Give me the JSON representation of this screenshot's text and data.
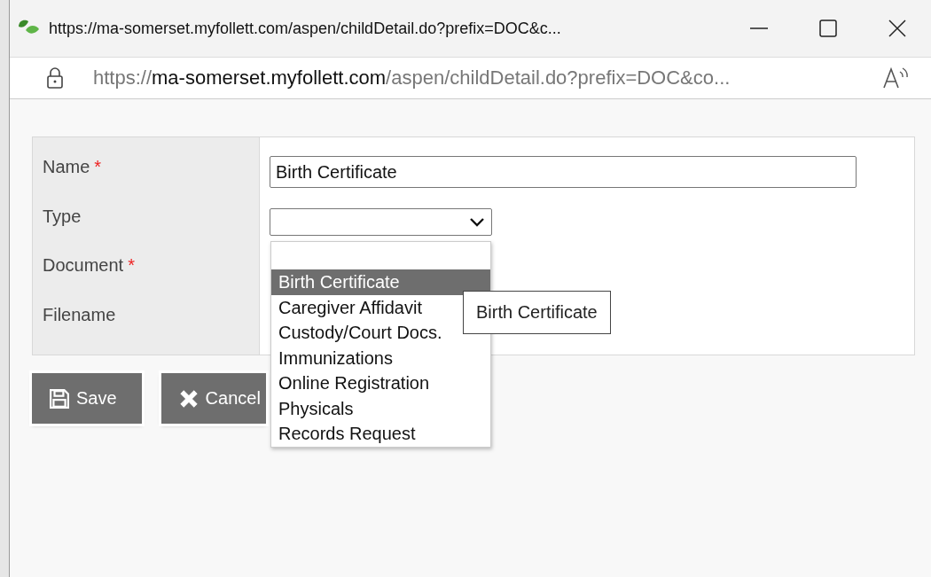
{
  "window": {
    "title": "https://ma-somerset.myfollett.com/aspen/childDetail.do?prefix=DOC&c..."
  },
  "address_bar": {
    "scheme": "https://",
    "host": "ma-somerset.myfollett.com",
    "path": "/aspen/childDetail.do?prefix=DOC&co..."
  },
  "form": {
    "fields": [
      {
        "label": "Name",
        "required_mark": "*",
        "kind": "text",
        "value": "Birth Certificate"
      },
      {
        "label": "Type",
        "kind": "select"
      },
      {
        "label": "Document",
        "required_mark": "*",
        "kind": "empty"
      },
      {
        "label": "Filename",
        "kind": "empty"
      }
    ]
  },
  "dropdown": {
    "options": [
      {
        "label": "Birth Certificate",
        "selected": true
      },
      {
        "label": "Caregiver Affidavit",
        "selected": false
      },
      {
        "label": "Custody/Court Docs.",
        "selected": false
      },
      {
        "label": "Immunizations",
        "selected": false
      },
      {
        "label": "Online Registration",
        "selected": false
      },
      {
        "label": "Physicals",
        "selected": false
      },
      {
        "label": "Records Request",
        "selected": false
      }
    ]
  },
  "tooltip": "Birth Certificate",
  "buttons": [
    {
      "label": "Save",
      "kind": "save"
    },
    {
      "label": "Cancel",
      "kind": "cancel"
    }
  ]
}
